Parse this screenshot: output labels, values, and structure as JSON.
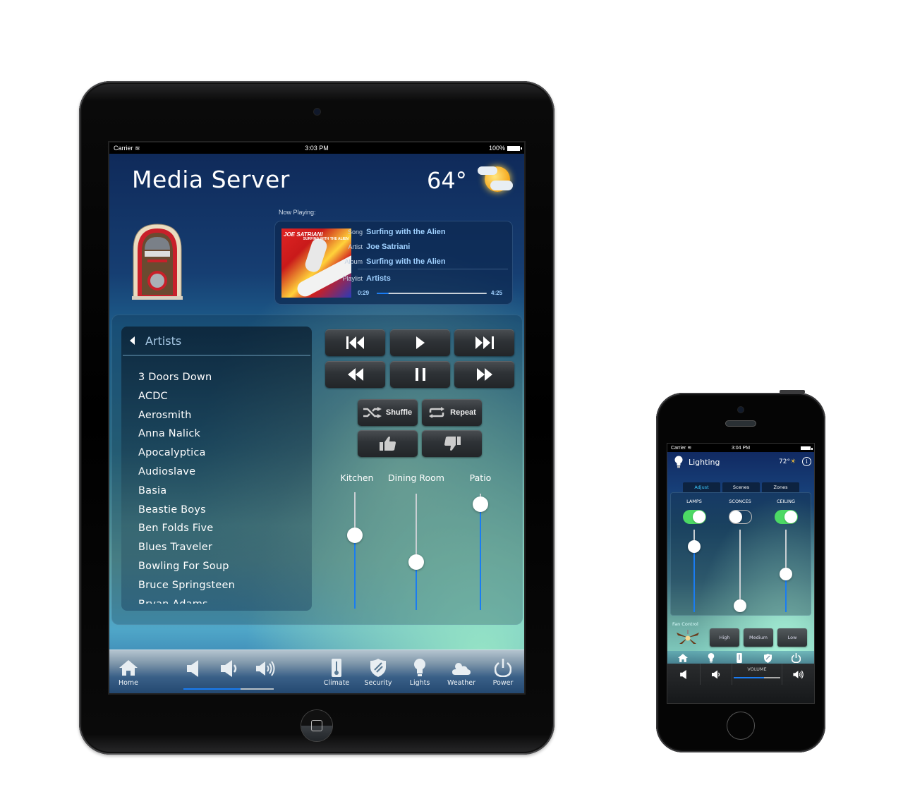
{
  "ipad": {
    "status_bar": {
      "carrier": "Carrier",
      "time": "3:03 PM",
      "battery": "100%"
    },
    "header": {
      "title": "Media Server",
      "temperature": "64°",
      "weather_icon": "partly-sunny-icon"
    },
    "now_playing": {
      "label": "Now Playing:",
      "album_art_title": "JOE SATRIANI",
      "album_art_subtitle": "SURFING WITH THE ALIEN",
      "song_key": "Song",
      "song": "Surfing with the Alien",
      "artist_key": "Artist",
      "artist": "Joe Satriani",
      "album_key": "Album",
      "album": "Surfing with the Alien",
      "playlist_key": "Playlist",
      "playlist": "Artists",
      "elapsed": "0:29",
      "duration": "4:25",
      "progress_fraction": 0.11
    },
    "browser": {
      "title": "Artists",
      "items": [
        "3 Doors Down",
        "ACDC",
        "Aerosmith",
        "Anna Nalick",
        "Apocalyptica",
        "Audioslave",
        "Basia",
        "Beastie Boys",
        "Ben Folds Five",
        "Blues Traveler",
        "Bowling For Soup",
        "Bruce Springsteen",
        "Bryan Adams"
      ]
    },
    "transport": {
      "previous_track": "skip-back-icon",
      "play": "play-icon",
      "next_track": "skip-forward-icon",
      "rewind": "rewind-icon",
      "pause": "pause-icon",
      "fast_forward": "fast-forward-icon",
      "shuffle_label": "Shuffle",
      "repeat_label": "Repeat",
      "thumbs_up": "thumbs-up-icon",
      "thumbs_down": "thumbs-down-icon"
    },
    "zones": [
      {
        "name": "Kitchen",
        "level": 0.65
      },
      {
        "name": "Dining Room",
        "level": 0.4
      },
      {
        "name": "Patio",
        "level": 0.97
      }
    ],
    "tabbar": {
      "home": "Home",
      "climate": "Climate",
      "security": "Security",
      "lights": "Lights",
      "weather": "Weather",
      "power": "Power",
      "volume_fraction": 0.63
    }
  },
  "iphone": {
    "status_bar": {
      "carrier": "Carrier",
      "time": "3:04 PM"
    },
    "header": {
      "title": "Lighting",
      "temperature": "72°",
      "info": "i"
    },
    "tabs": [
      {
        "label": "Adjust",
        "active": true
      },
      {
        "label": "Scenes",
        "active": false
      },
      {
        "label": "Zones",
        "active": false
      }
    ],
    "channels": [
      {
        "name": "LAMPS",
        "on": true,
        "level": 0.85
      },
      {
        "name": "SCONCES",
        "on": false,
        "level": 0.0
      },
      {
        "name": "CEILING",
        "on": true,
        "level": 0.45
      }
    ],
    "fan": {
      "label": "Fan Control",
      "buttons": [
        "High",
        "Medium",
        "Low"
      ]
    },
    "tabbar": {
      "home": "Home",
      "lights": "Lights",
      "climate": "Climate",
      "security": "Security",
      "power": "Power"
    },
    "volume": {
      "label": "VOLUME",
      "fraction": 0.65
    }
  },
  "colors": {
    "accent_blue": "#1a7cf2",
    "toggle_green": "#4cd964",
    "now_playing_value": "#9fd0ff"
  }
}
